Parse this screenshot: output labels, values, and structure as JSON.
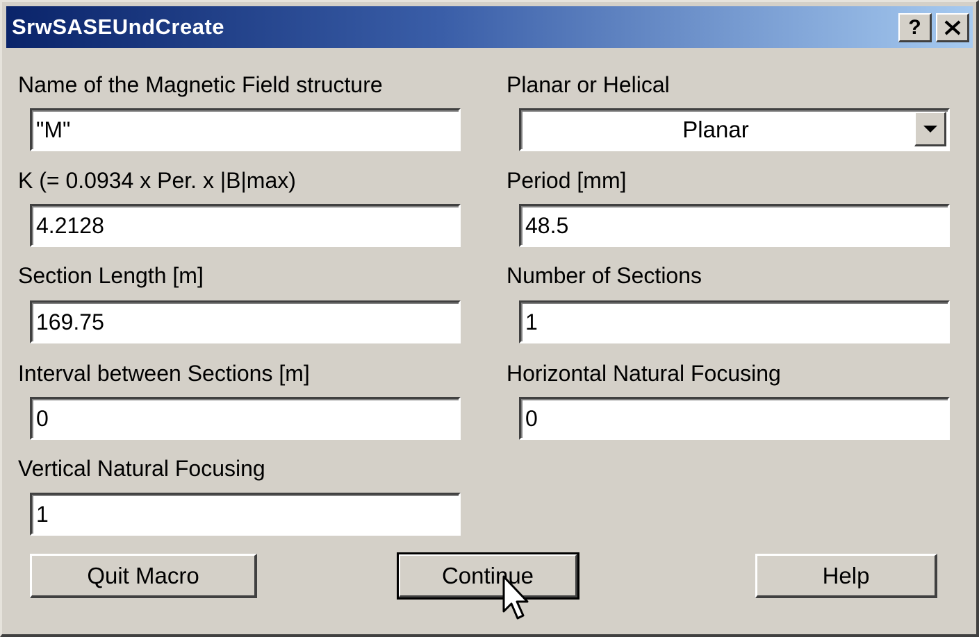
{
  "window": {
    "title": "SrwSASEUndCreate",
    "help_button": "?",
    "close_button": "close"
  },
  "fields": {
    "mag_name": {
      "label": "Name of the Magnetic Field structure",
      "value": "\"M\""
    },
    "planar_helical": {
      "label": "Planar or Helical",
      "value": "Planar"
    },
    "k_value": {
      "label": "K (= 0.0934 x Per. x |B|max)",
      "value": "4.2128"
    },
    "period": {
      "label": "Period [mm]",
      "value": "48.5"
    },
    "section_length": {
      "label": "Section Length [m]",
      "value": "169.75"
    },
    "num_sections": {
      "label": "Number of Sections",
      "value": "1"
    },
    "interval": {
      "label": "Interval between Sections [m]",
      "value": "0"
    },
    "horiz_focusing": {
      "label": "Horizontal Natural Focusing",
      "value": "0"
    },
    "vert_focusing": {
      "label": "Vertical Natural Focusing",
      "value": "1"
    }
  },
  "buttons": {
    "quit": "Quit Macro",
    "continue": "Continue",
    "help": "Help"
  },
  "colors": {
    "titlebar_start": "#0a246a",
    "titlebar_end": "#a6caf0",
    "face": "#d4d0c8"
  }
}
